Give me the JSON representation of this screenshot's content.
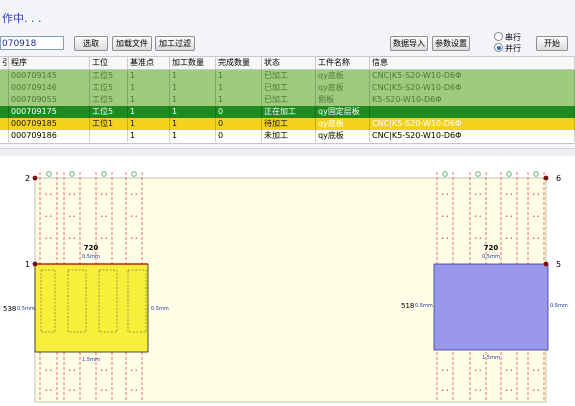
{
  "status_text": "作中. . .",
  "toolbar": {
    "search_value": "070918",
    "select_label": "选取",
    "load_file_label": "加载文件",
    "filter_label": "加工过滤",
    "import_label": "数据导入",
    "settings_label": "参数设置",
    "serial_label": "串行",
    "parallel_label": "并行",
    "start_label": "开始"
  },
  "table": {
    "headers": [
      "引",
      "程序",
      "工位",
      "基准点",
      "加工数量",
      "完成数量",
      "状态",
      "工件名称",
      "信息"
    ],
    "rows": [
      {
        "style": "green",
        "cells": [
          "",
          "000709145",
          "工位5",
          "1",
          "1",
          "1",
          "已加工",
          "qy底板",
          "CNC|K5-S20-W10-D6Φ"
        ]
      },
      {
        "style": "green",
        "cells": [
          "",
          "000709146",
          "工位5",
          "1",
          "1",
          "1",
          "已加工",
          "qy底板",
          "CNC|K5-S20-W10-D6Φ"
        ]
      },
      {
        "style": "green",
        "cells": [
          "",
          "000709055",
          "工位5",
          "1",
          "1",
          "1",
          "已加工",
          "侧板",
          "K5-S20-W10-D6Φ"
        ]
      },
      {
        "style": "sel",
        "cells": [
          "",
          "000709175",
          "工位5",
          "1",
          "1",
          "0",
          "正在加工",
          "qy固定层板",
          ""
        ]
      },
      {
        "style": "yellow",
        "cells": [
          "",
          "000709185",
          "工位1",
          "1",
          "1",
          "0",
          "待加工",
          "qy底板",
          "CNC|K5-S20-W10-D6Φ"
        ]
      },
      {
        "style": "white",
        "cells": [
          "",
          "000709186",
          "",
          "1",
          "1",
          "0",
          "未加工",
          "qy底板",
          "CNC|K5-S20-W10-D6Φ"
        ]
      }
    ]
  },
  "drawing": {
    "corner_labels": {
      "p1": "1",
      "p2": "2",
      "p5": "5",
      "p6": "6"
    },
    "left_part": {
      "width_label": "720",
      "height_label": "538",
      "margin_top": "0.5mm",
      "margin_left": "0.5mm",
      "margin_right": "0.5mm",
      "margin_bottom": "1.5mm"
    },
    "right_part": {
      "width_label": "720",
      "height_label": "518",
      "margin_top": "0.5mm",
      "margin_left": "0.5mm",
      "margin_right": "0.5mm",
      "margin_bottom": "1.5mm"
    },
    "colors": {
      "board": "#fffde6",
      "left_part": "#f7ef3a",
      "right_part": "#9a98ec",
      "guide": "#e23b3b",
      "hole": "#3aa84a"
    }
  }
}
